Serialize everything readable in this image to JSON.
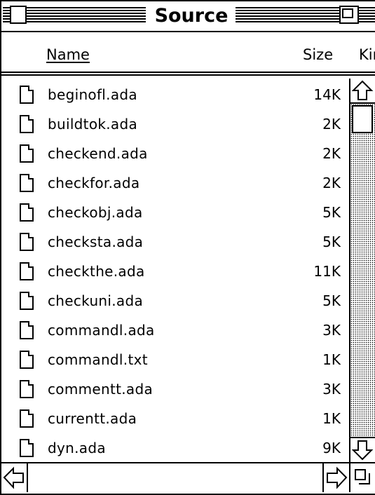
{
  "window": {
    "title": "Source"
  },
  "columns": {
    "name": "Name",
    "size": "Size",
    "kind": "Kir"
  },
  "files": [
    {
      "name": "beginofl.ada",
      "size": "14K"
    },
    {
      "name": "buildtok.ada",
      "size": "2K"
    },
    {
      "name": "checkend.ada",
      "size": "2K"
    },
    {
      "name": "checkfor.ada",
      "size": "2K"
    },
    {
      "name": "checkobj.ada",
      "size": "5K"
    },
    {
      "name": "checksta.ada",
      "size": "5K"
    },
    {
      "name": "checkthe.ada",
      "size": "11K"
    },
    {
      "name": "checkuni.ada",
      "size": "5K"
    },
    {
      "name": "commandl.ada",
      "size": "3K"
    },
    {
      "name": "commandl.txt",
      "size": "1K"
    },
    {
      "name": "commentt.ada",
      "size": "3K"
    },
    {
      "name": "currentt.ada",
      "size": "1K"
    },
    {
      "name": "dyn.ada",
      "size": "9K"
    }
  ],
  "icons": {
    "file": "document-icon",
    "up": "scroll-up-arrow-icon",
    "down": "scroll-down-arrow-icon",
    "left": "scroll-left-arrow-icon",
    "right": "scroll-right-arrow-icon"
  }
}
